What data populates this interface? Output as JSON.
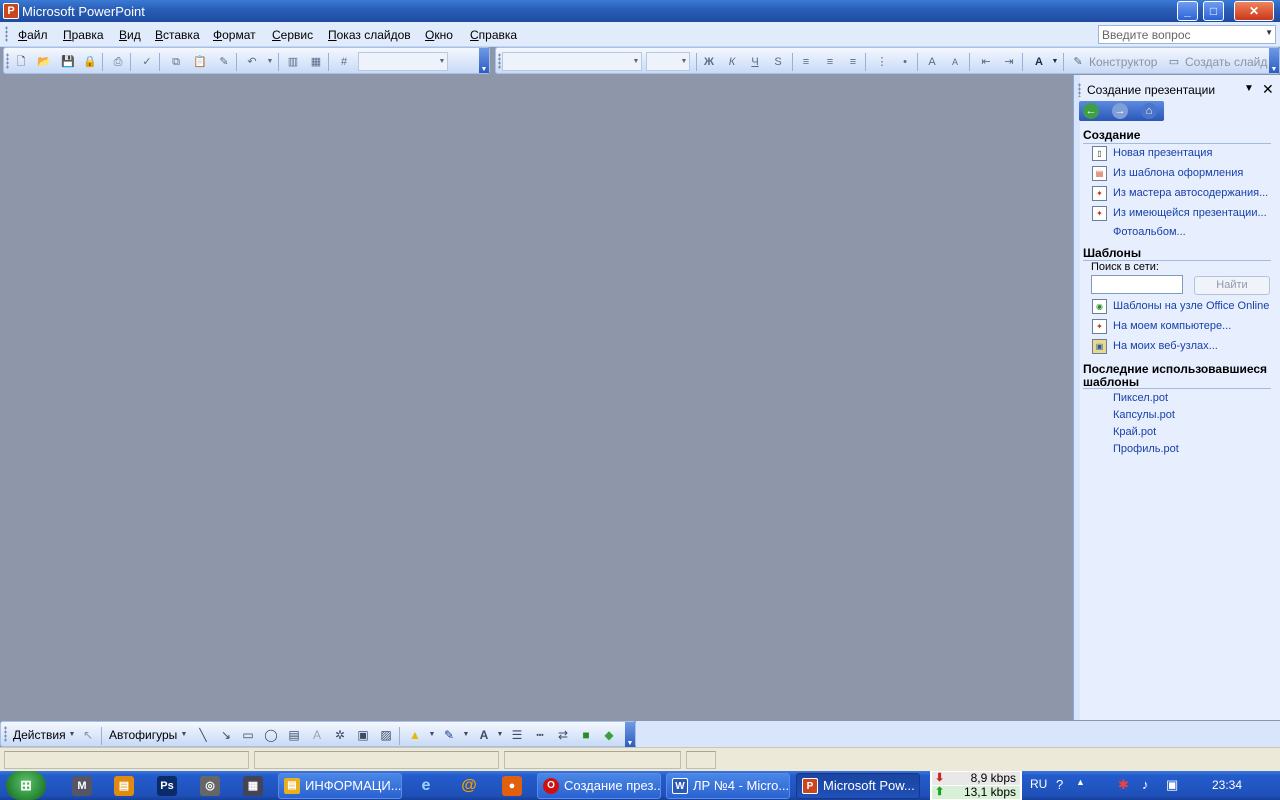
{
  "window": {
    "title": "Microsoft PowerPoint",
    "min": "_",
    "max": "□",
    "close": "✕"
  },
  "menu": {
    "items": [
      {
        "accel": "Ф",
        "rest": "айл"
      },
      {
        "accel": "П",
        "rest": "равка"
      },
      {
        "accel": "В",
        "rest": "ид"
      },
      {
        "accel": "В",
        "rest": "ставка"
      },
      {
        "accel": "Ф",
        "rest": "ормат"
      },
      {
        "accel": "С",
        "rest": "ервис"
      },
      {
        "accel": "П",
        "rest": "оказ слайдов"
      },
      {
        "accel": "О",
        "rest": "кно"
      },
      {
        "accel": "С",
        "rest": "правка"
      }
    ],
    "ask_placeholder": "Введите вопрос"
  },
  "toolbar": {
    "bold": "Ж",
    "italic": "К",
    "underline": "Ч",
    "shadow": "S",
    "font_color": "A",
    "designer": "Конструктор",
    "new_slide": "Создать слайд"
  },
  "taskpane": {
    "title": "Создание презентации",
    "section_create": "Создание",
    "create_links": [
      "Новая презентация",
      "Из шаблона оформления",
      "Из мастера автосодержания...",
      "Из имеющейся презентации...",
      "Фотоальбом..."
    ],
    "section_templates": "Шаблоны",
    "search_label": "Поиск в сети:",
    "search_value": "",
    "find_button": "Найти",
    "template_links": [
      "Шаблоны на узле Office Online",
      "На моем компьютере...",
      "На моих веб-узлах..."
    ],
    "section_recent_line1": "Последние использовавшиеся",
    "section_recent_line2": "шаблоны",
    "recent": [
      "Пиксел.pot",
      "Капсулы.pot",
      "Край.pot",
      "Профиль.pot"
    ]
  },
  "drawing": {
    "actions": "Действия",
    "autoshapes": "Автофигуры",
    "text_a": "A"
  },
  "taskbar": {
    "buttons": [
      "ИНФОРМАЦИ...",
      "Создание през...",
      "ЛР №4 - Micro...",
      "Microsoft Pow..."
    ],
    "net_down": "8,9 kbps",
    "net_up": "13,1 kbps",
    "lang": "RU",
    "clock": "23:34"
  }
}
